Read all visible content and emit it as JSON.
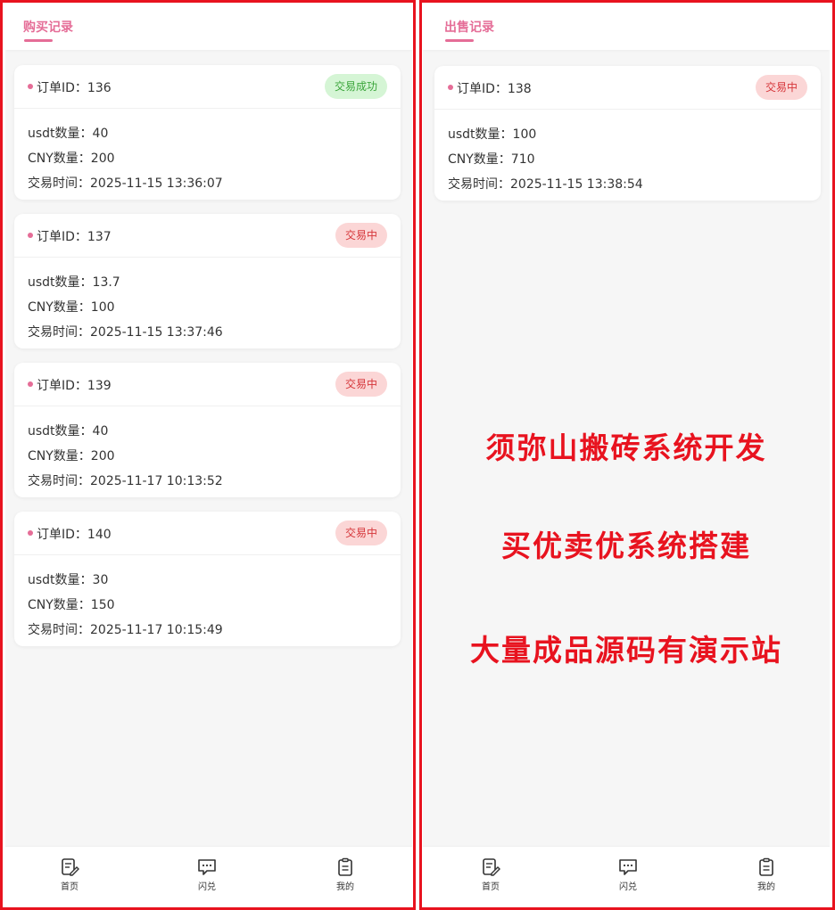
{
  "buy": {
    "tab_label": "购买记录",
    "orders": [
      {
        "id_label": "订单ID：136",
        "status": "交易成功",
        "usdt": "usdt数量：40",
        "cny": "CNY数量：200",
        "time": "交易时间：2025-11-15 13:36:07"
      },
      {
        "id_label": "订单ID：137",
        "status": "交易中",
        "usdt": "usdt数量：13.7",
        "cny": "CNY数量：100",
        "time": "交易时间：2025-11-15 13:37:46"
      },
      {
        "id_label": "订单ID：139",
        "status": "交易中",
        "usdt": "usdt数量：40",
        "cny": "CNY数量：200",
        "time": "交易时间：2025-11-17 10:13:52"
      },
      {
        "id_label": "订单ID：140",
        "status": "交易中",
        "usdt": "usdt数量：30",
        "cny": "CNY数量：150",
        "time": "交易时间：2025-11-17 10:15:49"
      }
    ]
  },
  "sell": {
    "tab_label": "出售记录",
    "orders": [
      {
        "id_label": "订单ID：138",
        "status": "交易中",
        "usdt": "usdt数量：100",
        "cny": "CNY数量：710",
        "time": "交易时间：2025-11-15 13:38:54"
      }
    ]
  },
  "promo": [
    "须弥山搬砖系统开发",
    "买优卖优系统搭建",
    "大量成品源码有演示站"
  ],
  "nav": [
    {
      "label": "首页",
      "icon": "edit-icon"
    },
    {
      "label": "闪兑",
      "icon": "message-icon"
    },
    {
      "label": "我的",
      "icon": "clipboard-icon"
    }
  ],
  "colors": {
    "accent": "#e56d97",
    "border_red": "#e8131f",
    "success_bg": "#d5f5d5",
    "success_text": "#3aa53a",
    "pending_bg": "#fbd6d6",
    "pending_text": "#d6363a"
  }
}
